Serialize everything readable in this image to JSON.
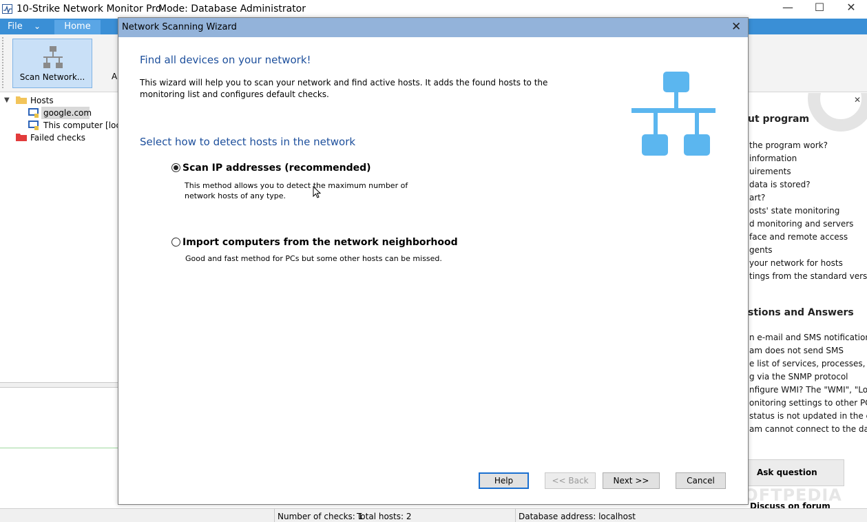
{
  "window": {
    "title": "10-Strike Network Monitor Pro",
    "mode": "Mode: Database Administrator",
    "controls": {
      "minimize": "—",
      "maximize": "☐",
      "close": "✕"
    }
  },
  "menu": {
    "file": "File",
    "file_arrow": "⌄",
    "home_tab": "Home"
  },
  "ribbon": {
    "scan_label": "Scan Network...",
    "next_partial": "A"
  },
  "tree": {
    "expander": "▼",
    "root": "Hosts",
    "hosts": [
      "google.com",
      "This computer [local"
    ],
    "failed": "Failed checks"
  },
  "dialog": {
    "title": "Network Scanning Wizard",
    "close": "✕",
    "heading": "Find all devices on your network!",
    "intro": "This wizard will help you to scan your network and find active hosts. It adds the found hosts to the monitoring list and configures default checks.",
    "section": "Select how to detect hosts in the network",
    "options": [
      {
        "label": "Scan IP addresses (recommended)",
        "desc": "This method allows you to detect the maximum number of network hosts of any type.",
        "selected": true
      },
      {
        "label": "Import computers from the network neighborhood",
        "desc": "Good and fast method for PCs but some other hosts can be missed.",
        "selected": false
      }
    ],
    "buttons": {
      "help": "Help",
      "back": "<< Back",
      "next": "Next >>",
      "cancel": "Cancel"
    }
  },
  "right_panel": {
    "close": "✕",
    "about_heading": "ut program",
    "about_links": [
      "the program work?",
      "information",
      "uirements",
      "data is stored?",
      "art?",
      "osts' state monitoring",
      "d monitoring and servers",
      "face and remote access",
      "gents",
      "your network for hosts",
      "tings from the standard versi..."
    ],
    "qa_heading": "stions and Answers",
    "qa_links": [
      "n e-mail and SMS notifications",
      "am does not send SMS",
      "e list of services, processes, a...",
      "g via the SNMP protocol",
      "nfigure WMI? The \"WMI\", \"Lo...",
      "onitoring settings to other PC",
      "status is not updated in the c...",
      "am cannot connect to the dat..."
    ],
    "ask_button": "Ask question",
    "discuss": "Discuss on forum",
    "watermark": "SOFTPEDIA"
  },
  "status": {
    "checks": "Number of checks: 1",
    "hosts": "Total hosts: 2",
    "database": "Database address: localhost"
  },
  "colors": {
    "menu_bar": "#3a8fd6",
    "dialog_title": "#93b3da",
    "heading_blue": "#1d4f9c",
    "network_icon": "#5bb6ef"
  }
}
